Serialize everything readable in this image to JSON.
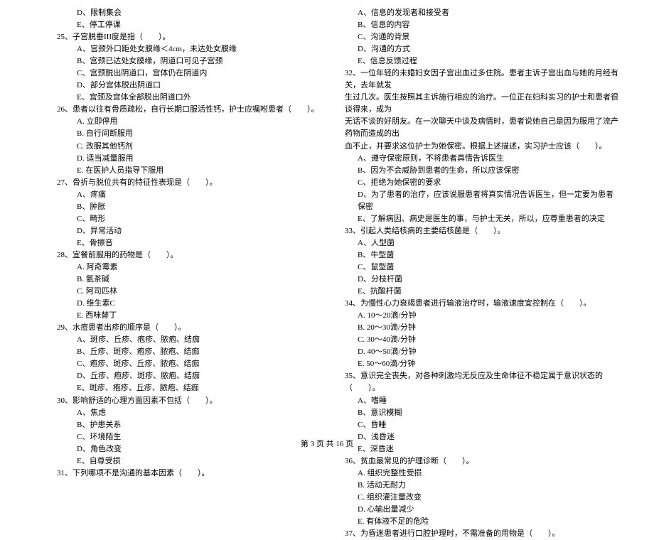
{
  "col1": {
    "q24opts": [
      "D、限制集会",
      "E、停工停课"
    ],
    "q25": "25、子宫脱垂III度是指（　　）。",
    "q25opts": [
      "A、宫颈外口距处女膜缘＜4cm，未达处女膜缘",
      "B、宫颈已达处女膜缘，阴道口可见子宫颈",
      "C、宫颈脱出阴道口，宫体仍在阴道内",
      "D、部分宫体脱出阴道口",
      "E、宫颈及宫体全部脱出阴道口外"
    ],
    "q26": "26、患者以往有骨质疏松，自行长期口服活性钙，护士应嘱咐患者（　　）。",
    "q26opts": [
      "A. 立即停用",
      "B. 自行间断服用",
      "C. 改服其他钙剂",
      "D. 适当减量服用",
      "E. 在医护人员指导下服用"
    ],
    "q27": "27、骨折与脱位共有的特征性表现是（　　）。",
    "q27opts": [
      "A、疼痛",
      "B、肿胀",
      "C、畸形",
      "D、异常活动",
      "E、骨擦音"
    ],
    "q28": "28、宜餐前服用的药物是（　　）。",
    "q28opts": [
      "A. 阿奇霉素",
      "B. 氨茶碱",
      "C. 阿司匹林",
      "D. 维生素C",
      "E. 西咪替丁"
    ],
    "q29": "29、水痘患者出疹的顺序是（　　）。",
    "q29opts": [
      "A、斑疹、丘疹、疱疹、脓疱、结痂",
      "B、丘疹、斑疹、疱疹、脓疱、结痂",
      "C、疱疹、斑疹、丘疹、脓疱、结痂",
      "D、丘疹、疱疹、斑疹、脓疱、结痂",
      "E、斑疹、疱疹、丘疹、脓疱、结痂"
    ],
    "q30": "30、影响舒适的心理方面因素不包括（　　）。",
    "q30opts": [
      "A、焦虑",
      "B、护患关系",
      "C、环境陌生",
      "D、角色改变",
      "E、自尊受损"
    ],
    "q31": "31、下列哪项不是沟通的基本因素（　　）。"
  },
  "col2": {
    "q31opts": [
      "A、信息的发现者和接受者",
      "B、信息的内容",
      "C、沟通的背景",
      "D、沟通的方式",
      "E、信息反馈过程"
    ],
    "q32a": "32、一位年轻的未婚妇女因子宫出血过多住院。患者主诉子宫出血与她的月经有关，去年就发",
    "q32b": "生过几次。医生按照其主诉施行相应的治疗。一位正在妇科实习的护士和患者很谈得来，成为",
    "q32c": "无话不谈的好朋友。在一次聊天中谈及病情时，患者说她自己是因为服用了流产药物而造成的出",
    "q32d": "血不止，并要求这位护士为她保密。根据上述描述，实习护士应该（　　）。",
    "q32opts": [
      "A、遵守保密原则，不将患者真情告诉医生",
      "B、因为不会威胁到患者的生命，所以应该保密",
      "C、拒绝为她保密的要求",
      "D、为了患者的治疗，应该说服患者将真实情况告诉医生，但一定要为患者保密",
      "E、了解病因、病史是医生的事，与护士无关，所以，应尊重患者的决定"
    ],
    "q33": "33、引起人类结核病的主要结核菌是（　　）。",
    "q33opts": [
      "A、人型菌",
      "B、牛型菌",
      "C、鼠型菌",
      "D、分枝杆菌",
      "E、抗酸杆菌"
    ],
    "q34": "34、为慢性心力衰竭患者进行输液治疗时，输液速度宜控制在（　　）。",
    "q34opts": [
      "A. 10～20滴/分钟",
      "B. 20～30滴/分钟",
      "C. 30～40滴/分钟",
      "D. 40～50滴/分钟",
      "E. 50～60滴/分钟"
    ],
    "q35": "35、意识完全丧失，对各种刺激均无反应及生命体征不稳定属于意识状态的（　　）。",
    "q35opts": [
      "A、嗜睡",
      "B、意识模糊",
      "C、昏睡",
      "D、浅昏迷",
      "E、深昏迷"
    ],
    "q36": "36、贫血最常见的护理诊断（　　）。",
    "q36opts": [
      "A. 组织完整性受损",
      "B. 活动无耐力",
      "C. 组织灌注量改变",
      "D. 心输出量减少",
      "E. 有体液不足的危险"
    ],
    "q37": "37、为昏迷患者进行口腔护理时，不需准备的用物是（　　）。"
  },
  "footer": "第 3 页 共 16 页"
}
